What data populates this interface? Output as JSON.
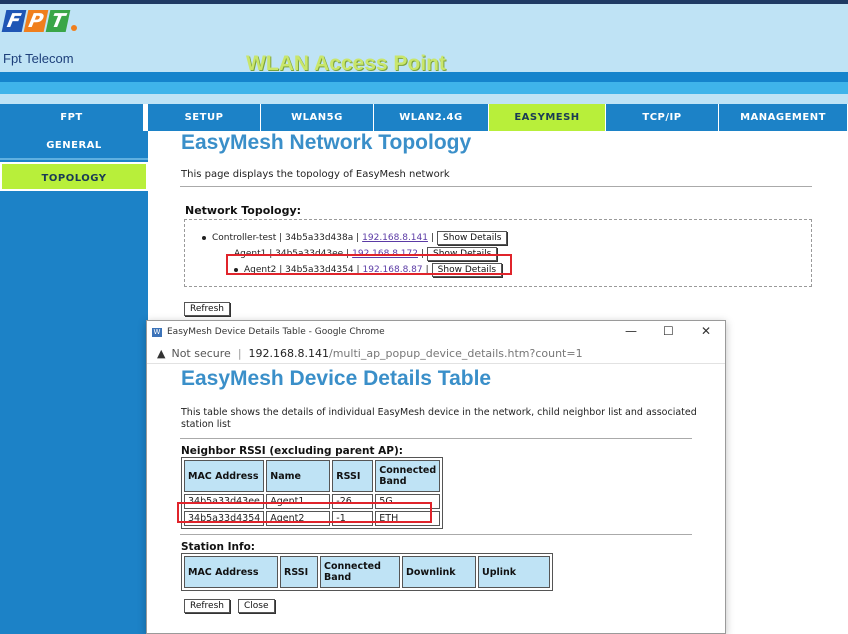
{
  "brand": {
    "logo_letters": [
      "F",
      "P",
      "T"
    ],
    "name": "Fpt Telecom",
    "header_title": "WLAN Access Point"
  },
  "colors": {
    "accent": "#1c82c7",
    "active": "#b8ef3a",
    "title": "#3a8fc9",
    "highlight": "#e0242b"
  },
  "nav": {
    "brand_tab": "FPT",
    "tabs": [
      "SETUP",
      "WLAN5G",
      "WLAN2.4G",
      "EASYMESH",
      "TCP/IP",
      "MANAGEMENT"
    ]
  },
  "sidebar": {
    "items": [
      "GENERAL",
      "TOPOLOGY"
    ]
  },
  "main": {
    "title": "EasyMesh Network Topology",
    "description": "This page displays the topology of EasyMesh network",
    "topology_label": "Network Topology:",
    "nodes": [
      {
        "text": "Controller-test | 34b5a33d438a |",
        "ip": "192.168.8.141",
        "sep": "|",
        "button": "Show Details"
      },
      {
        "text": "Agent1 | 34b5a33d43ee |",
        "ip": "192.168.8.172",
        "sep": "|",
        "button": "Show Details"
      },
      {
        "text": "Agent2 | 34b5a33d4354 |",
        "ip": "192.168.8.87",
        "sep": "|",
        "button": "Show Details"
      }
    ],
    "refresh": "Refresh"
  },
  "popup": {
    "window_title": "EasyMesh Device Details Table - Google Chrome",
    "controls": {
      "minimize": "—",
      "maximize": "☐",
      "close": "✕"
    },
    "not_secure": "Not secure",
    "url_host": "192.168.8.141",
    "url_path": "/multi_ap_popup_device_details.htm?count=1",
    "title": "EasyMesh Device Details Table",
    "description": "This table shows the details of individual EasyMesh device in the network, child neighbor list and associated station list",
    "neighbor_label": "Neighbor RSSI (excluding parent AP):",
    "neighbor_headers": [
      "MAC Address",
      "Name",
      "RSSI",
      "Connected Band"
    ],
    "neighbor_rows": [
      [
        "34b5a33d43ee",
        "Agent1",
        "-26",
        "5G"
      ],
      [
        "34b5a33d4354",
        "Agent2",
        "-1",
        "ETH"
      ]
    ],
    "station_label": "Station Info:",
    "station_headers": [
      "MAC Address",
      "RSSI",
      "Connected Band",
      "Downlink",
      "Uplink"
    ],
    "refresh": "Refresh",
    "close": "Close"
  }
}
